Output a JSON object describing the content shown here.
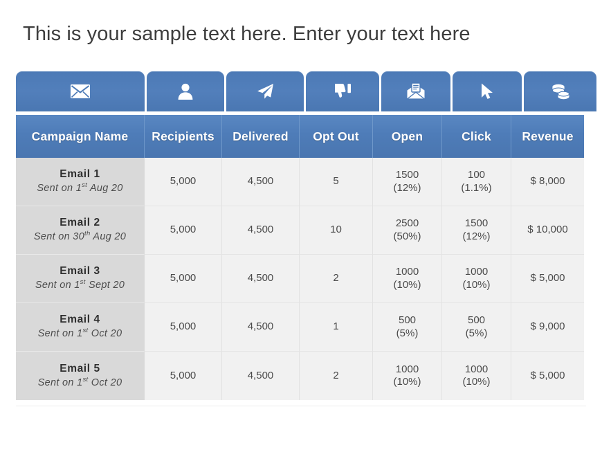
{
  "title": "This is your sample text here. Enter your text here",
  "theme": {
    "header_blue": "#4e7cb8",
    "tab_blue": "#4c7ab6",
    "name_col_bg": "#d9d9d9",
    "cell_bg": "#f1f1f1",
    "title_color": "#3d3d3d"
  },
  "tabs": [
    {
      "icon": "envelope-icon"
    },
    {
      "icon": "person-icon"
    },
    {
      "icon": "paper-plane-icon"
    },
    {
      "icon": "thumbs-down-icon"
    },
    {
      "icon": "open-envelope-document-icon"
    },
    {
      "icon": "cursor-arrow-icon"
    },
    {
      "icon": "coins-icon"
    }
  ],
  "table": {
    "columns": [
      "Campaign Name",
      "Recipients",
      "Delivered",
      "Opt Out",
      "Open",
      "Click",
      "Revenue"
    ],
    "rows": [
      {
        "name": "Email  1",
        "sent_prefix": "Sent on 1",
        "sent_ordinal": "st",
        "sent_suffix": " Aug 20",
        "recipients": "5,000",
        "delivered": "4,500",
        "opt_out": "5",
        "open_value": "1500",
        "open_pct": "(12%)",
        "click_value": "100",
        "click_pct": "(1.1%)",
        "revenue": "$ 8,000"
      },
      {
        "name": "Email  2",
        "sent_prefix": "Sent on 30",
        "sent_ordinal": "th",
        "sent_suffix": " Aug 20",
        "recipients": "5,000",
        "delivered": "4,500",
        "opt_out": "10",
        "open_value": "2500",
        "open_pct": "(50%)",
        "click_value": "1500",
        "click_pct": "(12%)",
        "revenue": "$ 10,000"
      },
      {
        "name": "Email  3",
        "sent_prefix": "Sent on 1",
        "sent_ordinal": "st",
        "sent_suffix": " Sept 20",
        "recipients": "5,000",
        "delivered": "4,500",
        "opt_out": "2",
        "open_value": "1000",
        "open_pct": "(10%)",
        "click_value": "1000",
        "click_pct": "(10%)",
        "revenue": "$ 5,000"
      },
      {
        "name": "Email  4",
        "sent_prefix": "Sent on 1",
        "sent_ordinal": "st",
        "sent_suffix": " Oct 20",
        "recipients": "5,000",
        "delivered": "4,500",
        "opt_out": "1",
        "open_value": "500",
        "open_pct": "(5%)",
        "click_value": "500",
        "click_pct": "(5%)",
        "revenue": "$ 9,000"
      },
      {
        "name": "Email  5",
        "sent_prefix": "Sent on 1",
        "sent_ordinal": "st",
        "sent_suffix": " Oct 20",
        "recipients": "5,000",
        "delivered": "4,500",
        "opt_out": "2",
        "open_value": "1000",
        "open_pct": "(10%)",
        "click_value": "1000",
        "click_pct": "(10%)",
        "revenue": "$ 5,000"
      }
    ]
  }
}
